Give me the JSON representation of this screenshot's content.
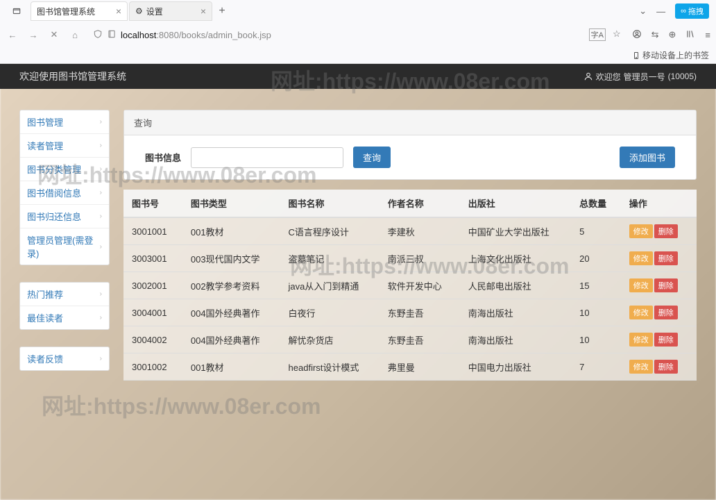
{
  "browser": {
    "tab1_title": "图书馆管理系统",
    "tab2_title": "设置",
    "url_host": "localhost",
    "url_rest": ":8080/books/admin_book.jsp",
    "bookmark_label": "移动设备上的书签",
    "blue_btn": "拖拽"
  },
  "header": {
    "title": "欢迎使用图书馆管理系统",
    "welcome": "欢迎您",
    "user_role": "管理员一号",
    "user_id": "(10005)"
  },
  "sidebar": {
    "group1": [
      "图书管理",
      "读者管理",
      "图书分类管理",
      "图书借阅信息",
      "图书归还信息",
      "管理员管理(需登录)"
    ],
    "group2": [
      "热门推荐",
      "最佳读者"
    ],
    "group3": [
      "读者反馈"
    ]
  },
  "search": {
    "panel_title": "查询",
    "label": "图书信息",
    "query_btn": "查询",
    "add_btn": "添加图书"
  },
  "table": {
    "headers": [
      "图书号",
      "图书类型",
      "图书名称",
      "作者名称",
      "出版社",
      "总数量",
      "操作"
    ],
    "edit": "修改",
    "delete": "删除",
    "rows": [
      {
        "no": "3001001",
        "type": "001教材",
        "name": "C语言程序设计",
        "author": "李建秋",
        "pub": "中国矿业大学出版社",
        "qty": "5"
      },
      {
        "no": "3003001",
        "type": "003现代国内文学",
        "name": "盗墓笔记",
        "author": "南派三叔",
        "pub": "上海文化出版社",
        "qty": "20"
      },
      {
        "no": "3002001",
        "type": "002教学参考资料",
        "name": "java从入门到精通",
        "author": "软件开发中心",
        "pub": "人民邮电出版社",
        "qty": "15"
      },
      {
        "no": "3004001",
        "type": "004国外经典著作",
        "name": "白夜行",
        "author": "东野圭吾",
        "pub": "南海出版社",
        "qty": "10"
      },
      {
        "no": "3004002",
        "type": "004国外经典著作",
        "name": "解忧杂货店",
        "author": "东野圭吾",
        "pub": "南海出版社",
        "qty": "10"
      },
      {
        "no": "3001002",
        "type": "001教材",
        "name": "headfirst设计模式",
        "author": "弗里曼",
        "pub": "中国电力出版社",
        "qty": "7"
      }
    ]
  },
  "watermark": "网址:https://www.08er.com"
}
